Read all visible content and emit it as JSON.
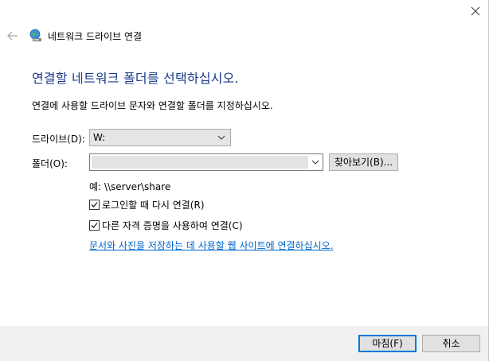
{
  "window": {
    "title": "네트워크 드라이브 연결"
  },
  "main": {
    "heading": "연결할 네트워크 폴더를 선택하십시오.",
    "description": "연결에 사용할 드라이브 문자와 연결할 폴더를 지정하십시오.",
    "drive_label": "드라이브(D):",
    "drive_value": "W:",
    "folder_label": "폴더(O):",
    "folder_value": "",
    "browse_label": "찾아보기(B)...",
    "example_text": "예: \\\\server\\share",
    "reconnect_label": "로그인할 때 다시 연결(R)",
    "reconnect_checked": true,
    "other_creds_label": "다른 자격 증명을 사용하여 연결(C)",
    "other_creds_checked": true,
    "link_text": "문서와 사진을 저장하는 데 사용할 웹 사이트에 연결하십시오."
  },
  "footer": {
    "finish_label": "마침(F)",
    "cancel_label": "취소"
  },
  "colors": {
    "heading": "#1a3a8a",
    "link": "#0066cc",
    "footer_bg": "#f0f0f0",
    "default_button_border": "#0078d7"
  },
  "icons": {
    "close": "close-icon",
    "back": "back-arrow-icon",
    "title": "network-drive-icon",
    "dropdown": "chevron-down-icon",
    "check": "checkmark-icon"
  }
}
